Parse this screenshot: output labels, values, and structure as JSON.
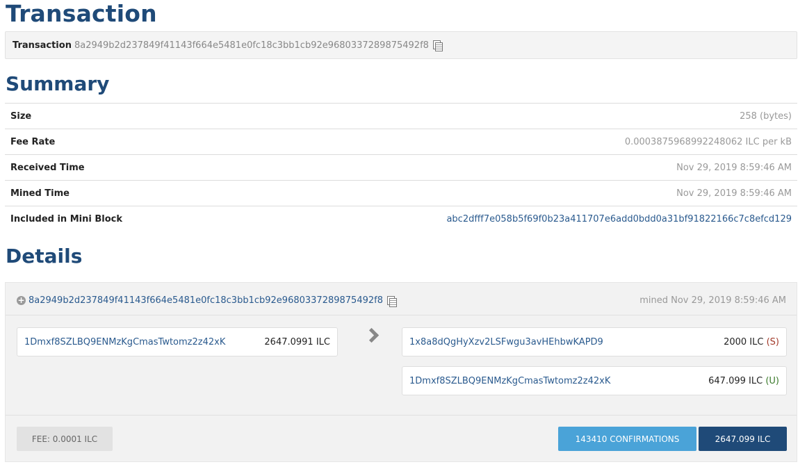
{
  "page": {
    "title": "Transaction",
    "summary_heading": "Summary",
    "details_heading": "Details"
  },
  "txbar": {
    "label": "Transaction",
    "hash": "8a2949b2d237849f41143f664e5481e0fc18c3bb1cb92e9680337289875492f8",
    "copy_icon": "copy-icon"
  },
  "summary": [
    {
      "key": "Size",
      "value": "258 (bytes)"
    },
    {
      "key": "Fee Rate",
      "value": "0.0003875968992248062 ILC per kB"
    },
    {
      "key": "Received Time",
      "value": "Nov 29, 2019 8:59:46 AM"
    },
    {
      "key": "Mined Time",
      "value": "Nov 29, 2019 8:59:46 AM"
    },
    {
      "key": "Included in Mini Block",
      "value": "abc2dfff7e058b5f69f0b23a411707e6add0bdd0a31bf91822166c7c8efcd129"
    }
  ],
  "details": {
    "hash": "8a2949b2d237849f41143f664e5481e0fc18c3bb1cb92e9680337289875492f8",
    "mined": "mined Nov 29, 2019 8:59:46 AM",
    "inputs": [
      {
        "address": "1Dmxf8SZLBQ9ENMzKgCmasTwtomz2z42xK",
        "amount": "2647.0991 ILC"
      }
    ],
    "outputs": [
      {
        "address": "1x8a8dQgHyXzv2LSFwgu3avHEhbwKAPD9",
        "amount": "2000 ILC",
        "open": "(",
        "tag": "S",
        "close": ")"
      },
      {
        "address": "1Dmxf8SZLBQ9ENMzKgCmasTwtomz2z42xK",
        "amount": "647.099 ILC",
        "open": "(",
        "tag": "U",
        "close": ")"
      }
    ],
    "fee": "FEE: 0.0001 ILC",
    "confirmations": "143410 CONFIRMATIONS",
    "total": "2647.099 ILC"
  },
  "colors": {
    "heading": "#1f4a78",
    "link": "#2a5a8e",
    "confirmations_bg": "#4aa3d8",
    "total_bg": "#1f4a78"
  }
}
